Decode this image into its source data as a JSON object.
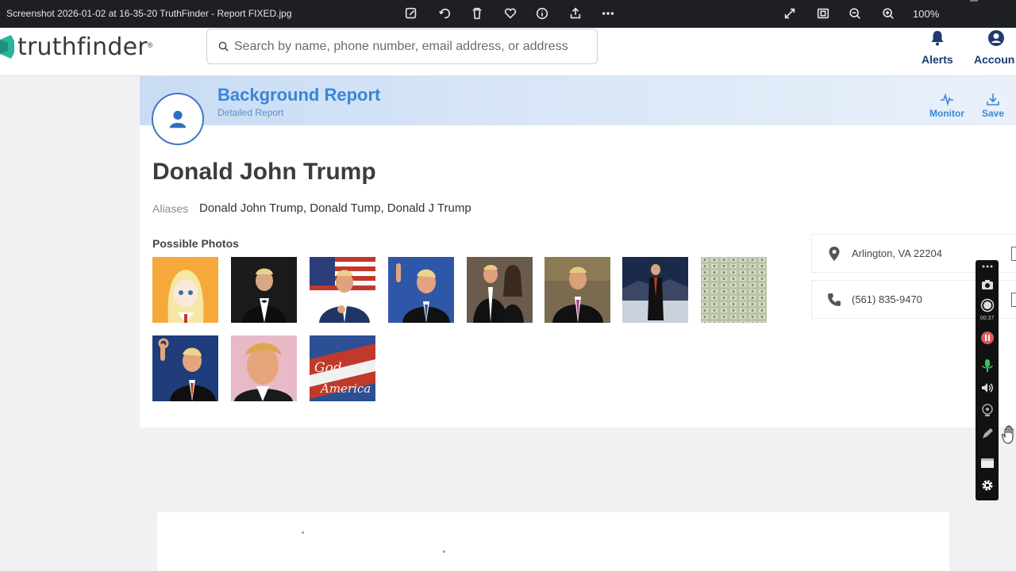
{
  "viewer": {
    "title": "Screenshot 2026-01-02 at 16-35-20 TruthFinder - Report FIXED.jpg",
    "zoom": "100%",
    "toolbar_icons": [
      "edit-icon",
      "rotate-icon",
      "delete-icon",
      "favorite-icon",
      "info-icon",
      "share-icon",
      "more-icon"
    ],
    "right_icons": [
      "expand-icon",
      "fit-icon",
      "zoom-out-icon",
      "zoom-in-icon"
    ]
  },
  "site": {
    "logo_text": "truthfinder",
    "logo_reg": "®",
    "brand_color": "#2bb39c",
    "search_placeholder": "Search by name, phone number, email address, or address",
    "alerts_label": "Alerts",
    "account_label": "Accoun"
  },
  "report": {
    "title": "Background Report",
    "subtitle": "Detailed Report",
    "monitor_label": "Monitor",
    "save_label": "Save",
    "name": "Donald John Trump",
    "aliases_label": "Aliases",
    "aliases": "Donald John Trump, Donald Tump, Donald J Trump",
    "photos_label": "Possible Photos",
    "photo_count": 11,
    "location": "Arlington, VA 22204",
    "phone": "(561) 835-9470",
    "accent_color": "#3a86d6"
  },
  "recorder": {
    "timer": "00:37",
    "icons": [
      "camera-icon",
      "record-icon",
      "pause-icon",
      "microphone-icon",
      "speaker-icon",
      "webcam-icon",
      "pen-icon",
      "window-icon",
      "settings-icon"
    ]
  }
}
